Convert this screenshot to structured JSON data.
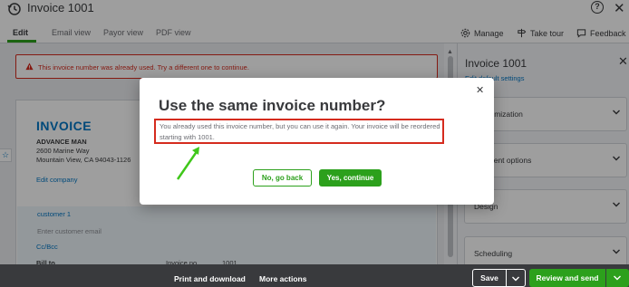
{
  "header": {
    "title": "Invoice 1001",
    "tabs": [
      {
        "label": "Edit"
      },
      {
        "label": "Email view"
      },
      {
        "label": "Payor view"
      },
      {
        "label": "PDF view"
      }
    ],
    "actions": {
      "manage": "Manage",
      "take_tour": "Take tour",
      "feedback": "Feedback"
    }
  },
  "error_banner": {
    "text": "This invoice number was already used. Try a different one to continue."
  },
  "invoice": {
    "heading": "INVOICE",
    "company_name": "ADVANCE MAN",
    "address_line1": "2600 Marine Way",
    "address_line2": "Mountain View, CA 94043-1126",
    "edit_company": "Edit company",
    "customer": "customer 1",
    "email_placeholder": "Enter customer email",
    "cc_bcc": "Cc/Bcc",
    "bill_to": "Bill to",
    "invoice_no_label": "Invoice no.",
    "invoice_no_value": "1001"
  },
  "right_panel": {
    "title": "Invoice 1001",
    "link": "Edit default settings",
    "sections": [
      {
        "label": "Customization"
      },
      {
        "label": "Payment options"
      },
      {
        "label": "Design"
      },
      {
        "label": "Scheduling"
      }
    ]
  },
  "bottom_bar": {
    "print": "Print and download",
    "more": "More actions",
    "save": "Save",
    "review_send": "Review and send"
  },
  "modal": {
    "title": "Use the same invoice number?",
    "body": "You already used this invoice number, but you can use it again. Your invoice will be reordered starting with 1001.",
    "no_button": "No, go back",
    "yes_button": "Yes, continue"
  },
  "colors": {
    "accent_green": "#2ca01c",
    "link_blue": "#0077c5",
    "error_red": "#d52b1e",
    "annotation_green": "#3fc71a"
  }
}
